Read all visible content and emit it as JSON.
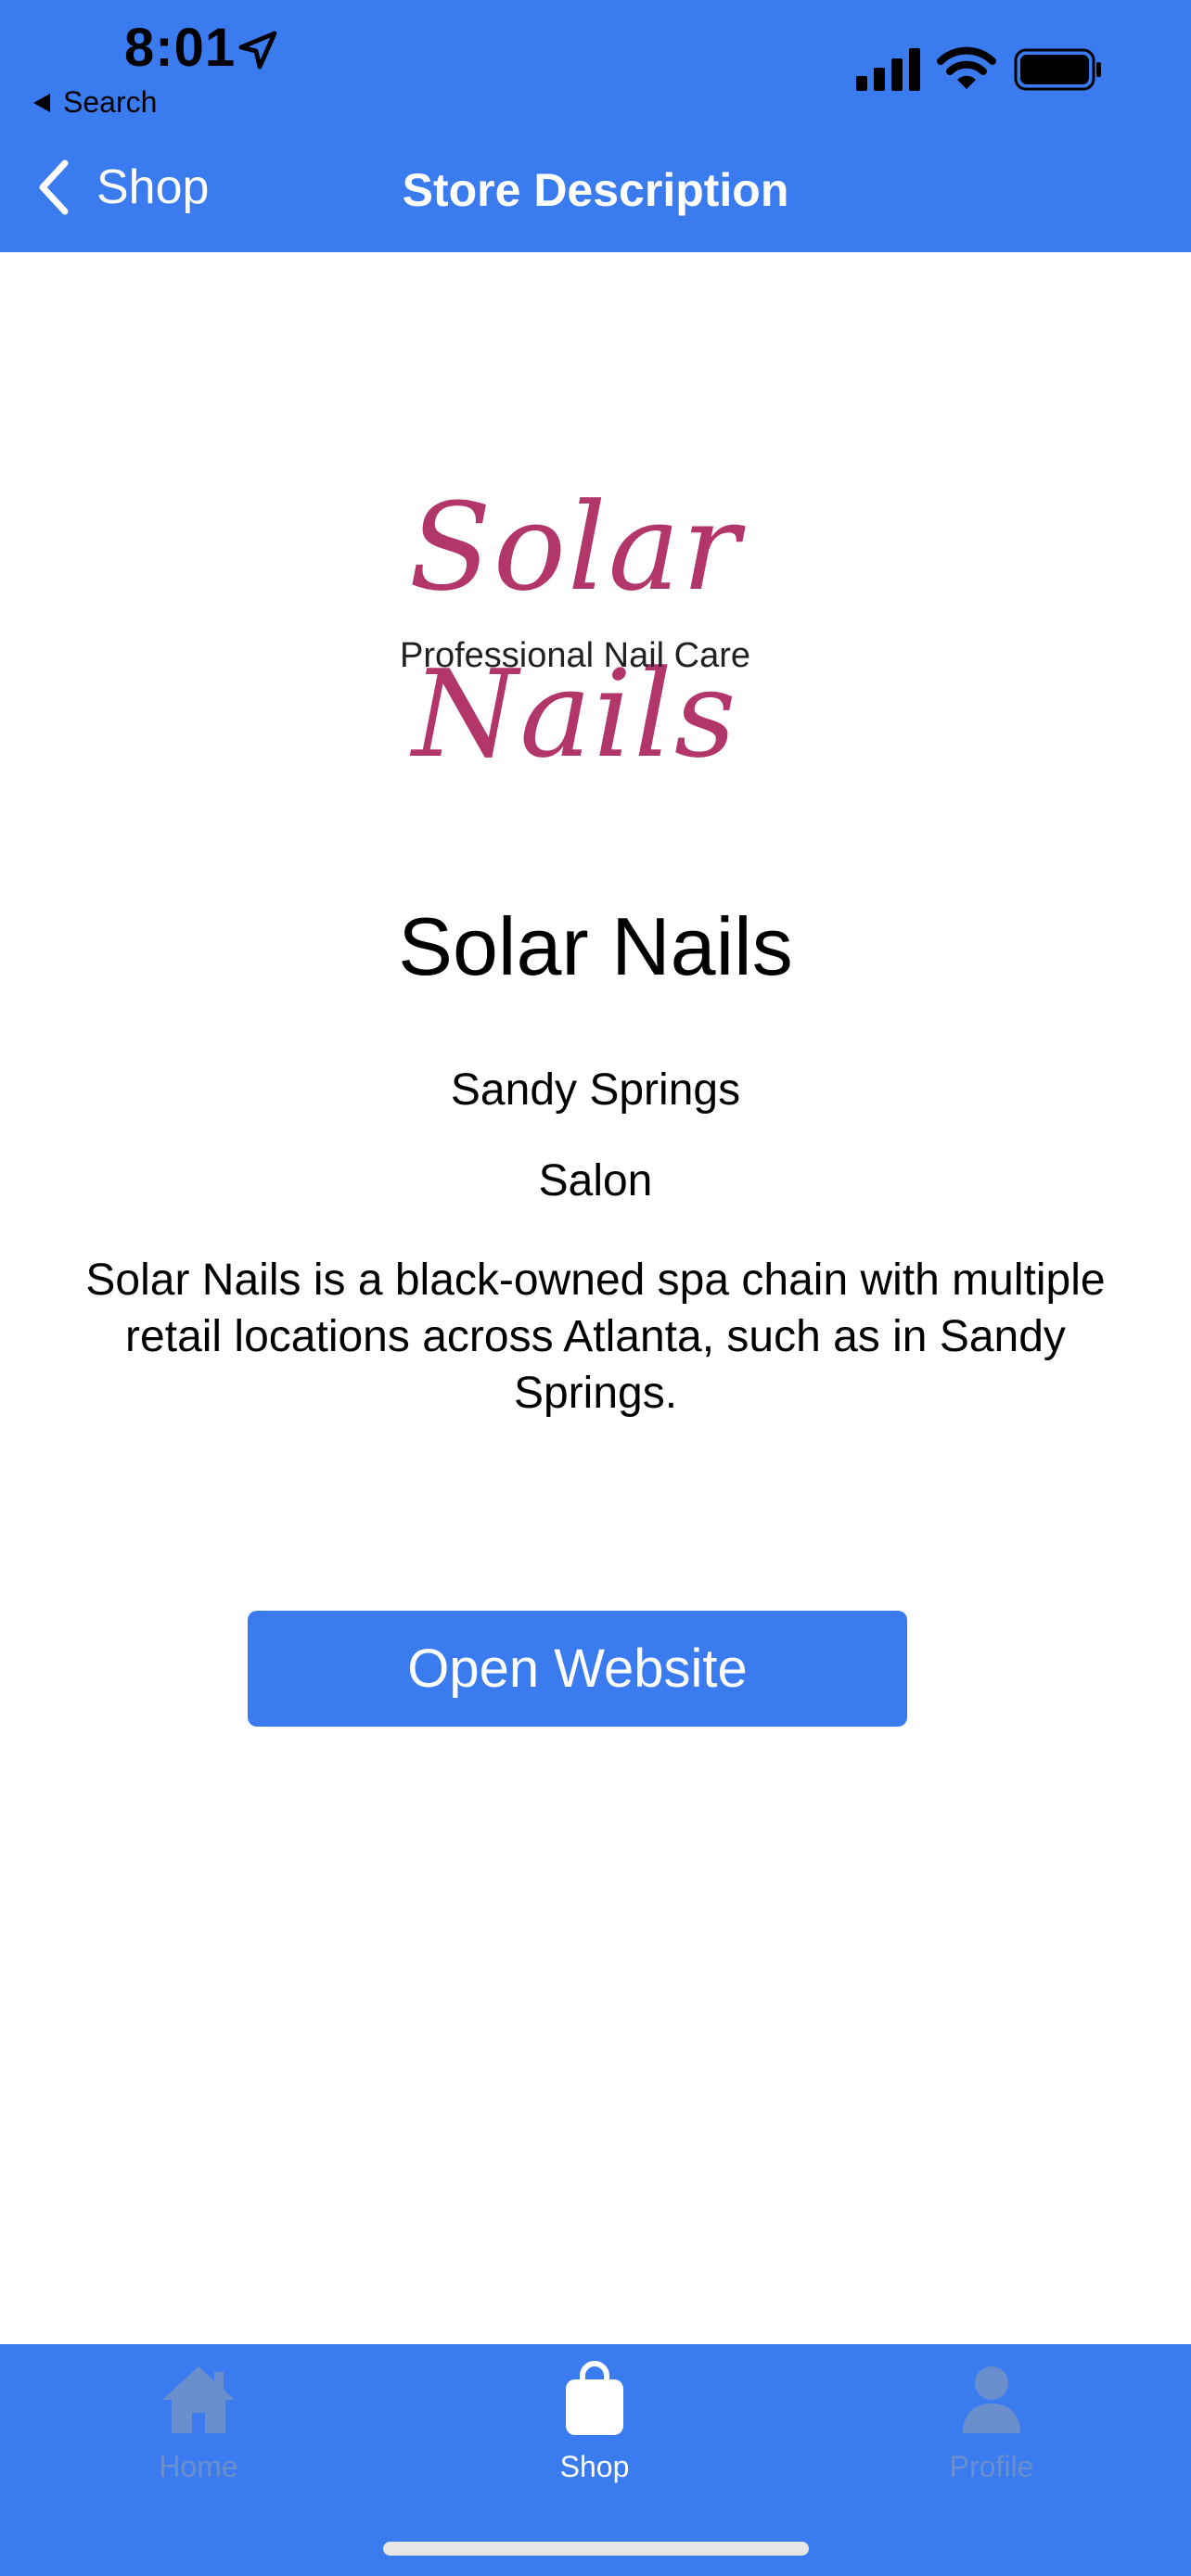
{
  "status_bar": {
    "time": "8:01",
    "back_app_label": "Search"
  },
  "nav": {
    "back_label": "Shop",
    "title": "Store Description"
  },
  "logo": {
    "script_text": "Solar Nails",
    "tagline": "Professional Nail Care",
    "color": "#b2366a"
  },
  "store": {
    "name": "Solar Nails",
    "location": "Sandy Springs",
    "category": "Salon",
    "description": "Solar Nails is a black-owned spa chain with multiple retail locations across Atlanta, such as in Sandy Springs."
  },
  "actions": {
    "open_website_label": "Open Website"
  },
  "tab_bar": {
    "tabs": [
      {
        "label": "Home",
        "icon": "home-icon",
        "active": false
      },
      {
        "label": "Shop",
        "icon": "shopping-bag-icon",
        "active": true
      },
      {
        "label": "Profile",
        "icon": "person-icon",
        "active": false
      }
    ]
  },
  "colors": {
    "accent": "#3a7bf0",
    "inactive_tab": "#6a8fcc",
    "active_tab": "#ffffff"
  }
}
